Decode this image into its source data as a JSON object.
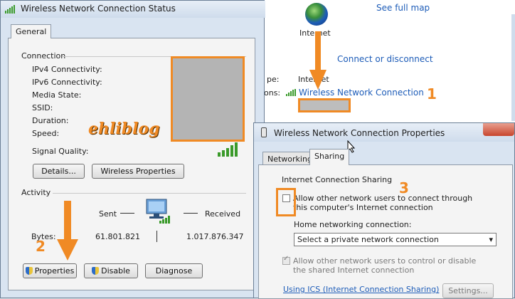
{
  "background": {
    "internet_label": "Internet",
    "see_full_map": "See full map",
    "connect_disconnect": "Connect or disconnect",
    "type_label_partial": "pe:",
    "type_value": "Internet",
    "conn_label_partial": "ons:",
    "connection_link": "Wireless Network Connection",
    "step1": "1"
  },
  "status_window": {
    "title": "Wireless Network Connection Status",
    "tab": "General",
    "connection_header": "Connection",
    "rows": [
      {
        "label": "IPv4 Connectivity:"
      },
      {
        "label": "IPv6 Connectivity:"
      },
      {
        "label": "Media State:"
      },
      {
        "label": "SSID:"
      },
      {
        "label": "Duration:"
      },
      {
        "label": "Speed:"
      }
    ],
    "signal_quality": "Signal Quality:",
    "details_button": "Details...",
    "wireless_properties_button": "Wireless Properties",
    "activity_header": "Activity",
    "sent_label": "Sent",
    "received_label": "Received",
    "bytes_label": "Bytes:",
    "bytes_sent": "61.801.821",
    "bytes_received": "1.017.876.347",
    "properties_button": "Properties",
    "disable_button": "Disable",
    "diagnose_button": "Diagnose",
    "watermark": "ehliblog",
    "step2": "2"
  },
  "properties_window": {
    "title": "Wireless Network Connection Properties",
    "tabs": [
      "Networking",
      "Sharing"
    ],
    "ics_header": "Internet Connection Sharing",
    "allow_connect": "Allow other network users to connect through this computer's Internet connection",
    "home_networking_label": "Home networking connection:",
    "select_value": "Select a private network connection",
    "allow_control": "Allow other network users to control or disable the shared Internet connection",
    "using_ics_link": "Using ICS (Internet Connection Sharing)",
    "settings_button": "Settings...",
    "step3": "3"
  },
  "colors": {
    "accent_orange": "#f08a24",
    "link_blue": "#1d5cb8"
  }
}
